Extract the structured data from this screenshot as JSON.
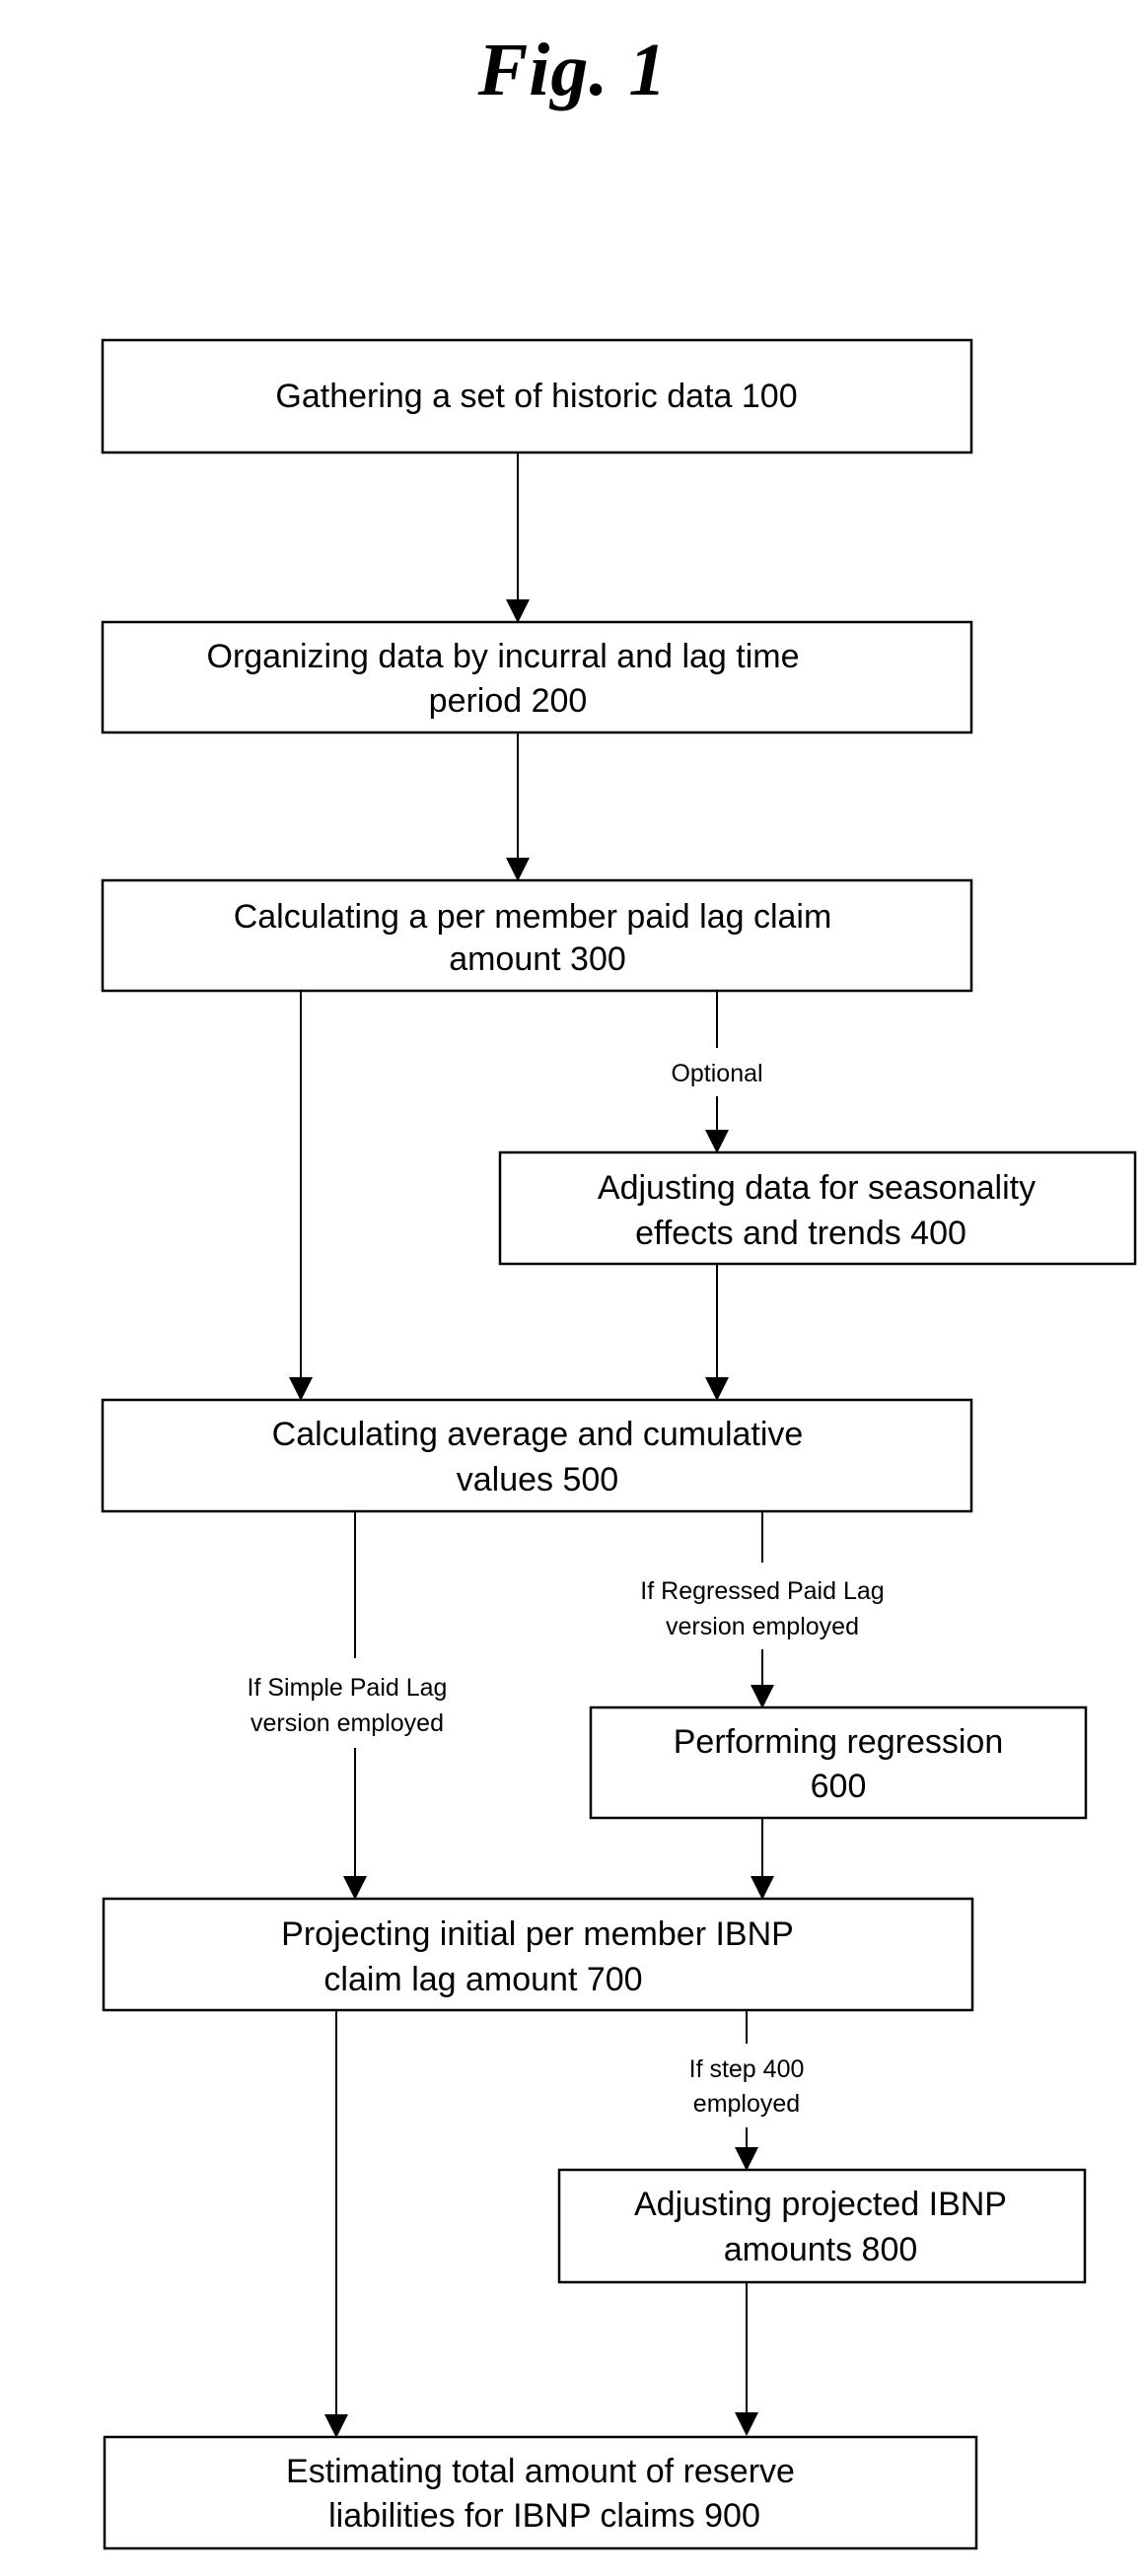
{
  "figure": {
    "title": "Fig. 1"
  },
  "steps": {
    "s100": {
      "line1": "Gathering a set of historic data 100",
      "line2": ""
    },
    "s200": {
      "line1": "Organizing data by incurral and lag time",
      "line2": "period 200"
    },
    "s300": {
      "line1": "Calculating a per member paid lag claim",
      "line2": "amount 300"
    },
    "s400": {
      "line1": "Adjusting data for seasonality",
      "line2": "effects and trends 400"
    },
    "s500": {
      "line1": "Calculating average and cumulative",
      "line2": "values  500"
    },
    "s600": {
      "line1": "Performing regression",
      "line2": "600"
    },
    "s700": {
      "line1": "Projecting initial per member IBNP",
      "line2": "claim lag amount 700"
    },
    "s800": {
      "line1": "Adjusting projected IBNP",
      "line2": "amounts 800"
    },
    "s900": {
      "line1": "Estimating total amount of reserve",
      "line2": "liabilities for IBNP claims  900"
    }
  },
  "edge_labels": {
    "optional": {
      "line1": "Optional"
    },
    "regressed": {
      "line1": "If Regressed Paid Lag",
      "line2": "version employed"
    },
    "simple": {
      "line1": "If Simple Paid Lag",
      "line2": "version employed"
    },
    "step400": {
      "line1": "If step 400",
      "line2": "employed"
    }
  }
}
